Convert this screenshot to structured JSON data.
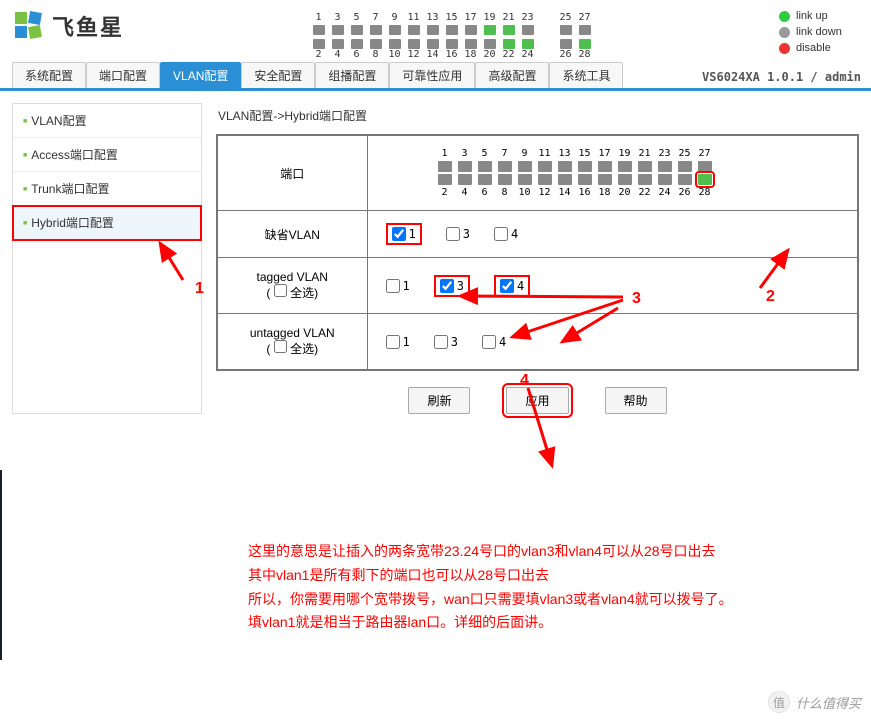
{
  "brand": {
    "name": "飞鱼星"
  },
  "legend": {
    "up": "link up",
    "down": "link down",
    "dis": "disable"
  },
  "ports_top": {
    "odd": [
      1,
      3,
      5,
      7,
      9,
      11,
      13,
      15,
      17,
      19,
      21,
      23,
      25,
      27
    ],
    "even": [
      2,
      4,
      6,
      8,
      10,
      12,
      14,
      16,
      18,
      20,
      22,
      24,
      26,
      28
    ],
    "up_ports": [
      19,
      21,
      22,
      24,
      28
    ]
  },
  "nav": {
    "items": [
      "系统配置",
      "端口配置",
      "VLAN配置",
      "安全配置",
      "组播配置",
      "可靠性应用",
      "高级配置",
      "系统工具"
    ],
    "active_index": 2,
    "right": "VS6024XA 1.0.1 / admin"
  },
  "sidebar": {
    "items": [
      "VLAN配置",
      "Access端口配置",
      "Trunk端口配置",
      "Hybrid端口配置"
    ],
    "active_index": 3
  },
  "breadcrumb": "VLAN配置->Hybrid端口配置",
  "table": {
    "port_label": "端口",
    "grid": {
      "odd": [
        1,
        3,
        5,
        7,
        9,
        11,
        13,
        15,
        17,
        19,
        21,
        23,
        25,
        27
      ],
      "even": [
        2,
        4,
        6,
        8,
        10,
        12,
        14,
        16,
        18,
        20,
        22,
        24,
        26,
        28
      ],
      "up": [
        28
      ],
      "selected": [
        28
      ]
    },
    "rows": {
      "default_vlan": {
        "label": "缺省VLAN",
        "opts": [
          {
            "v": "1",
            "chk": true,
            "hi": true
          },
          {
            "v": "3",
            "chk": false,
            "hi": false
          },
          {
            "v": "4",
            "chk": false,
            "hi": false
          }
        ]
      },
      "tagged": {
        "label": "tagged VLAN",
        "sub": "全选",
        "opts": [
          {
            "v": "1",
            "chk": false,
            "hi": false
          },
          {
            "v": "3",
            "chk": true,
            "hi": true
          },
          {
            "v": "4",
            "chk": true,
            "hi": true
          }
        ]
      },
      "untagged": {
        "label": "untagged VLAN",
        "sub": "全选",
        "opts": [
          {
            "v": "1",
            "chk": false,
            "hi": false
          },
          {
            "v": "3",
            "chk": false,
            "hi": false
          },
          {
            "v": "4",
            "chk": false,
            "hi": false
          }
        ]
      }
    }
  },
  "buttons": {
    "refresh": "刷新",
    "apply": "应用",
    "help": "帮助"
  },
  "anno": {
    "n1": "1",
    "n2": "2",
    "n3": "3",
    "n4": "4",
    "text": "这里的意思是让插入的两条宽带23.24号口的vlan3和vlan4可以从28号口出去\n其中vlan1是所有剩下的端口也可以从28号口出去\n所以，你需要用哪个宽带拨号，wan口只需要填vlan3或者vlan4就可以拨号了。\n填vlan1就是相当于路由器lan口。详细的后面讲。"
  },
  "watermark": {
    "char": "值",
    "text": "什么值得买"
  }
}
